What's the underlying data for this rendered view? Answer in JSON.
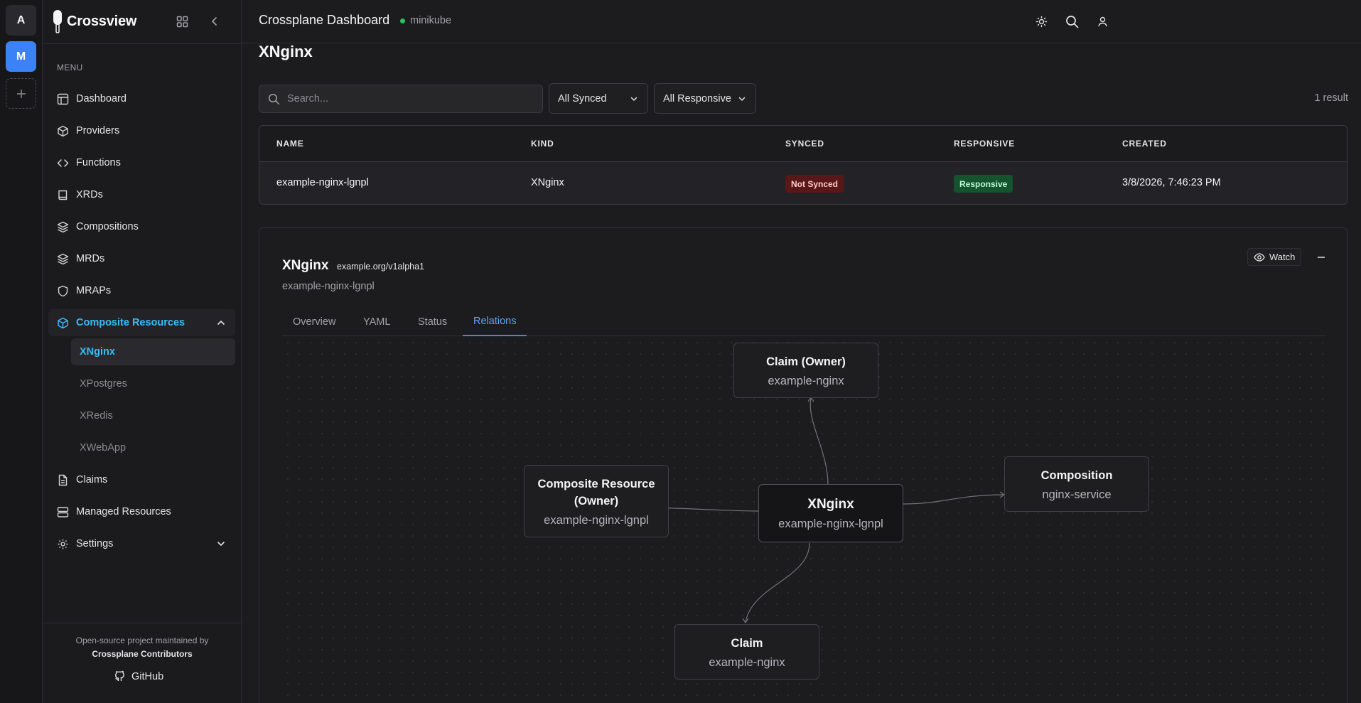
{
  "workspaces": [
    "A",
    "M"
  ],
  "brand": {
    "name": "Crossview"
  },
  "sidebar": {
    "menu_label": "MENU",
    "items": [
      {
        "label": "Dashboard",
        "icon": "layout-dashboard-icon"
      },
      {
        "label": "Providers",
        "icon": "package-icon"
      },
      {
        "label": "Functions",
        "icon": "code-icon"
      },
      {
        "label": "XRDs",
        "icon": "book-icon"
      },
      {
        "label": "Compositions",
        "icon": "layers-icon"
      },
      {
        "label": "MRDs",
        "icon": "layers-icon"
      },
      {
        "label": "MRAPs",
        "icon": "shield-icon"
      },
      {
        "label": "Composite Resources",
        "icon": "box-icon"
      },
      {
        "label": "Claims",
        "icon": "file-text-icon"
      },
      {
        "label": "Managed Resources",
        "icon": "server-icon"
      },
      {
        "label": "Settings",
        "icon": "gear-icon"
      }
    ],
    "sub_items": [
      "XNginx",
      "XPostgres",
      "XRedis",
      "XWebApp"
    ],
    "footer": {
      "line1": "Open-source project maintained by",
      "line2": "Crossplane Contributors",
      "github": "GitHub"
    }
  },
  "topbar": {
    "title": "Crossplane Dashboard",
    "context": "minikube",
    "status_color": "#22c55e"
  },
  "main": {
    "page_title": "XNginx",
    "search": {
      "placeholder": "Search...",
      "value": ""
    },
    "filters": {
      "synced": "All Synced",
      "responsive": "All Responsive"
    },
    "result_count": "1 result",
    "table": {
      "headers": [
        "NAME",
        "KIND",
        "SYNCED",
        "RESPONSIVE",
        "CREATED"
      ],
      "rows": [
        {
          "name": "example-nginx-lgnpl",
          "kind": "XNginx",
          "synced": "Not Synced",
          "responsive": "Responsive",
          "created": "3/8/2026, 7:46:23 PM"
        }
      ]
    }
  },
  "detail": {
    "kind": "XNginx",
    "api_version": "example.org/v1alpha1",
    "name": "example-nginx-lgnpl",
    "watch_label": "Watch",
    "tabs": [
      "Overview",
      "YAML",
      "Status",
      "Relations"
    ],
    "active_tab": "Relations",
    "graph": {
      "nodes": [
        {
          "kind": "Claim (Owner)",
          "name": "example-nginx"
        },
        {
          "kind": "Composite Resource (Owner)",
          "name": "example-nginx-lgnpl"
        },
        {
          "kind": "XNginx",
          "name": "example-nginx-lgnpl"
        },
        {
          "kind": "Composition",
          "name": "nginx-service"
        },
        {
          "kind": "Claim",
          "name": "example-nginx"
        }
      ]
    }
  },
  "colors": {
    "accent": "#3b82f6",
    "active_text": "#38bdf8",
    "badge_not_synced_bg": "#5a1717",
    "badge_responsive_bg": "#14532d"
  }
}
